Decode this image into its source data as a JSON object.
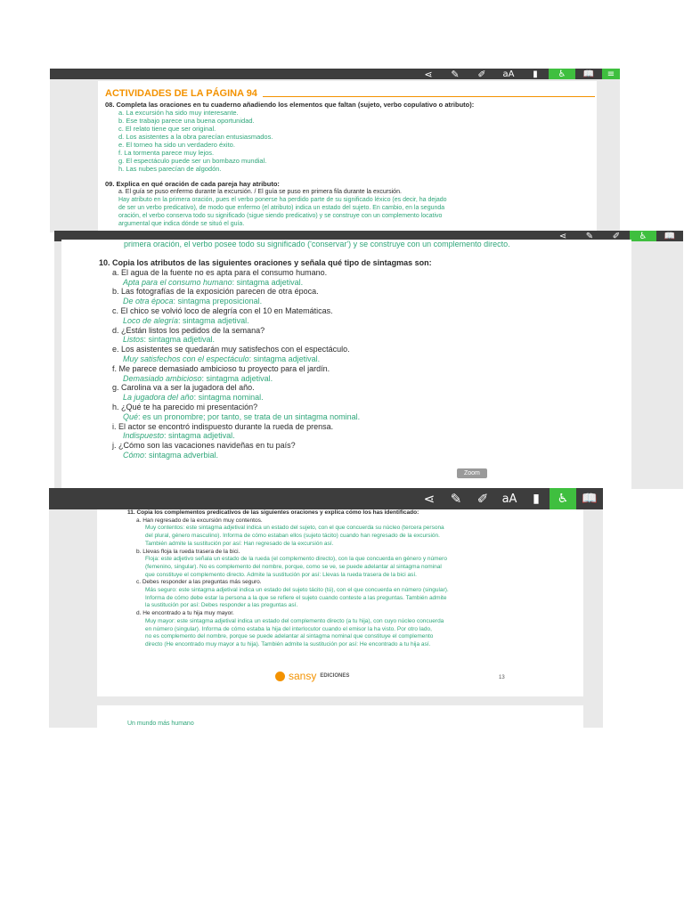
{
  "toolbar": {
    "icons": [
      "share-icon",
      "pencil-icon",
      "marker-icon",
      "font-size-icon",
      "bookmark-icon",
      "accessibility-icon",
      "book-icon"
    ],
    "font_size_label": "aA",
    "accent_color": "#3fbf3f",
    "bar_color": "#3d3d3d",
    "text_color": "#2fa67a",
    "heading_color": "#f39200"
  },
  "shot1": {
    "title": "ACTIVIDADES DE LA PÁGINA 94",
    "q08": {
      "prompt": "08. Completa las oraciones en tu cuaderno añadiendo los elementos que faltan (sujeto, verbo copulativo o atributo):",
      "items": [
        "a. La excursión ha sido muy interesante.",
        "b. Ese trabajo parece una buena oportunidad.",
        "c. El relato tiene que ser original.",
        "d. Los asistentes a la obra parecían entusiasmados.",
        "e. El torneo ha sido un verdadero éxito.",
        "f. La tormenta parece muy lejos.",
        "g. El espectáculo puede ser un bombazo mundial.",
        "h. Las nubes parecían de algodón."
      ]
    },
    "q09": {
      "prompt": "09. Explica en qué oración de cada pareja hay atributo:",
      "item_a": "a. El guía se puso enfermo durante la excursión. / El guía se puso en primera fila durante la excursión.",
      "answer_lines": [
        "Hay atributo en la primera oración, pues el verbo ponerse ha perdido parte de su significado léxico (es decir, ha dejado",
        "de ser un verbo predicativo), de modo que enfermo (el atributo) indica un estado del sujeto. En cambio, en la segunda",
        "oración, el verbo conserva todo su significado (sigue siendo predicativo) y se construye con un complemento locativo",
        "argumental que indica dónde se situó el guía."
      ]
    }
  },
  "shot2": {
    "overlap_line": "primera oración, el verbo posee todo su significado ('conservar') y se construye con un complemento directo.",
    "q10": {
      "prompt": "10. Copia los atributos de las siguientes oraciones y señala qué tipo de sintagmas son:",
      "items": [
        {
          "q": "a. El agua de la fuente no es apta para el consumo humano.",
          "attr": "Apta para el consumo humano",
          "type": ": sintagma adjetival."
        },
        {
          "q": "b. Las fotografías de la exposición parecen de otra época.",
          "attr": "De otra época",
          "type": ": sintagma preposicional."
        },
        {
          "q": "c. El chico se volvió loco de alegría con el 10 en Matemáticas.",
          "attr": "Loco de alegría",
          "type": ": sintagma adjetival."
        },
        {
          "q": "d. ¿Están listos los pedidos de la semana?",
          "attr": "Listos",
          "type": ": sintagma adjetival."
        },
        {
          "q": "e. Los asistentes se quedarán muy satisfechos con el espectáculo.",
          "attr": "Muy satisfechos con el espectáculo",
          "type": ": sintagma adjetival."
        },
        {
          "q": "f. Me parece demasiado ambicioso tu proyecto para el jardín.",
          "attr": "Demasiado ambicioso",
          "type": ": sintagma adjetival."
        },
        {
          "q": "g. Carolina va a ser la jugadora del año.",
          "attr": "La jugadora del año",
          "type": ": sintagma nominal."
        },
        {
          "q": "h. ¿Qué te ha parecido mi presentación?",
          "attr": "Qué",
          "type": ": es un pronombre; por tanto, se trata de un sintagma nominal."
        },
        {
          "q": "i. El actor se encontró indispuesto durante la rueda de prensa.",
          "attr": "Indispuesto",
          "type": ": sintagma adjetival."
        },
        {
          "q": "j. ¿Cómo son las vacaciones navideñas en tu país?",
          "attr": "Cómo",
          "type": ": sintagma adverbial."
        }
      ]
    },
    "zoom_label": "Zoom"
  },
  "shot3": {
    "q11_prompt": "11. Copia los complementos predicativos de las siguientes oraciones y explica cómo los has identificado:",
    "lines": [
      {
        "kind": "q",
        "text": "a. Han regresado de la excursión muy contentos."
      },
      {
        "kind": "a",
        "text": "Muy contentos: este sintagma adjetival indica un estado del sujeto, con el que concuerda su núcleo (tercera persona"
      },
      {
        "kind": "a",
        "text": "del plural, género masculino). Informa de cómo estaban ellos (sujeto tácito) cuando han regresado de la excursión."
      },
      {
        "kind": "a",
        "text": "También admite la sustitución por así: Han regresado de la excursión así."
      },
      {
        "kind": "q",
        "text": "b. Llevas floja la rueda trasera de la bici."
      },
      {
        "kind": "a",
        "text": "Floja: este adjetivo señala un estado de la rueda (el complemento directo), con la que concuerda en género y número"
      },
      {
        "kind": "a",
        "text": "(femenino, singular). No es complemento del nombre, porque, como se ve, se puede adelantar al sintagma nominal"
      },
      {
        "kind": "a",
        "text": "que constituye el complemento directo. Admite la sustitución por así: Llevas la rueda trasera de la bici así."
      },
      {
        "kind": "q",
        "text": "c. Debes responder a las preguntas más seguro."
      },
      {
        "kind": "a",
        "text": "Más seguro: este sintagma adjetival indica un estado del sujeto tácito (tú), con el que concuerda en número (singular)."
      },
      {
        "kind": "a",
        "text": "Informa de cómo debe estar la persona a la que se refiere el sujeto cuando conteste a las preguntas. También admite"
      },
      {
        "kind": "a",
        "text": "la sustitución por así: Debes responder a las preguntas así."
      },
      {
        "kind": "q",
        "text": "d. He encontrado a tu hija muy mayor."
      },
      {
        "kind": "a",
        "text": "Muy mayor: este sintagma adjetival indica un estado del complemento directo (a tu hija), con cuyo núcleo concuerda"
      },
      {
        "kind": "a",
        "text": "en número (singular). Informa de cómo estaba la hija del interlocutor cuando el emisor la ha visto. Por otro lado,"
      },
      {
        "kind": "a",
        "text": "no es complemento del nombre, porque se puede adelantar al sintagma nominal que constituye el complemento"
      },
      {
        "kind": "a",
        "text": "directo (He encontrado muy mayor a tu hija). También admite la sustitución por así: He encontrado a tu hija así."
      }
    ],
    "brand": "sansy",
    "brand_sub": "EDICIONES",
    "page_number": "13",
    "next_page_text": "Un mundo más humano"
  }
}
